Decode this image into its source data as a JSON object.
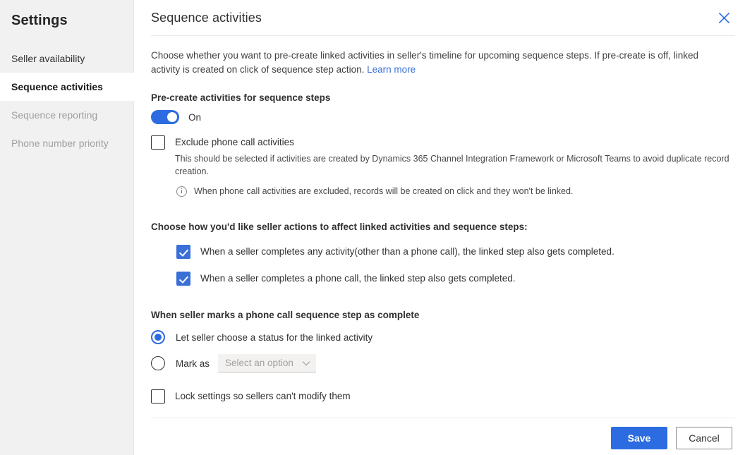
{
  "sidebar": {
    "title": "Settings",
    "items": [
      {
        "label": "Seller availability",
        "selected": false,
        "disabled": false
      },
      {
        "label": "Sequence activities",
        "selected": true,
        "disabled": false
      },
      {
        "label": "Sequence reporting",
        "selected": false,
        "disabled": true
      },
      {
        "label": "Phone number priority",
        "selected": false,
        "disabled": true
      }
    ]
  },
  "panel": {
    "title": "Sequence activities",
    "close_icon": "close-icon",
    "description": "Choose whether you want to pre-create linked activities in seller's timeline for upcoming sequence steps. If pre-create is off, linked activity is created on click of sequence step action. ",
    "learn_more": "Learn more"
  },
  "precreate": {
    "label": "Pre-create activities for sequence steps",
    "toggle_state": "on",
    "toggle_label": "On"
  },
  "exclude": {
    "checkbox_label": "Exclude phone call activities",
    "checked": false,
    "sub_description": "This should be selected if activities are created by Dynamics 365 Channel Integration Framework or Microsoft Teams to avoid duplicate record creation.",
    "info_icon": "info-icon",
    "info_text": "When phone call activities are excluded, records will be created on click and they won't be linked."
  },
  "seller_actions": {
    "heading": "Choose how you'd like seller actions to affect linked activities and sequence steps:",
    "options": [
      {
        "label": "When a seller completes any activity(other than a phone call), the linked step also gets completed.",
        "checked": true
      },
      {
        "label": "When a seller completes a phone call, the linked step also gets completed.",
        "checked": true
      }
    ]
  },
  "phone_complete": {
    "heading": "When seller marks a phone call sequence step as complete",
    "option_let_seller": "Let seller choose a status for the linked activity",
    "option_mark_as": "Mark as",
    "dropdown_placeholder": "Select an option",
    "dropdown_icon": "chevron-down-icon",
    "selected_option": "let_seller"
  },
  "lock": {
    "label": "Lock settings so sellers can't modify them",
    "checked": false
  },
  "footer": {
    "save_label": "Save",
    "cancel_label": "Cancel"
  },
  "colors": {
    "accent": "#2c6ce0",
    "link": "#3a6fd8",
    "checkbox_checked": "#3a6fd8",
    "sidebar_bg": "#f1f1f1",
    "close_icon": "#2c6ce0"
  }
}
